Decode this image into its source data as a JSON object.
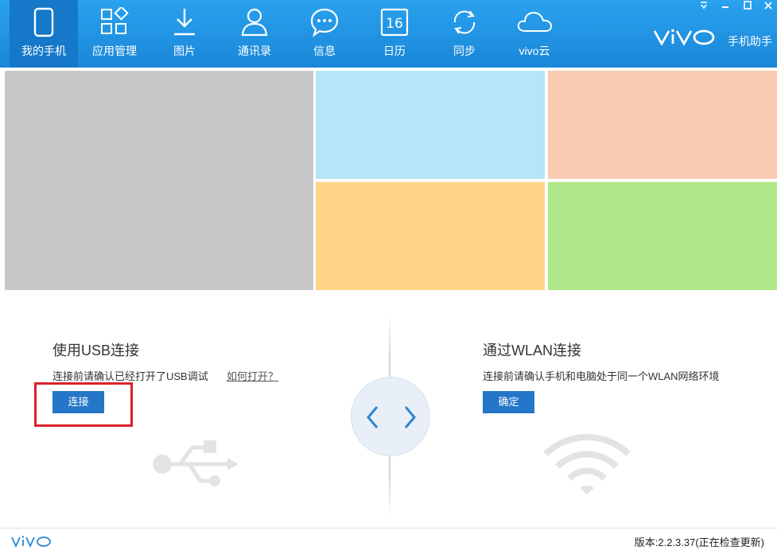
{
  "nav": {
    "items": [
      {
        "label": "我的手机",
        "icon": "phone-icon"
      },
      {
        "label": "应用管理",
        "icon": "apps-icon"
      },
      {
        "label": "图片",
        "icon": "download-icon"
      },
      {
        "label": "通讯录",
        "icon": "contact-icon"
      },
      {
        "label": "信息",
        "icon": "message-icon"
      },
      {
        "label": "日历",
        "icon": "calendar-icon"
      },
      {
        "label": "同步",
        "icon": "sync-icon"
      },
      {
        "label": "vivo云",
        "icon": "cloud-icon"
      }
    ],
    "calendar_day": "16",
    "brand_text": "手机助手"
  },
  "colors": {
    "nav_bg": "#1a86d8",
    "tile_gray": "#c8c8c8",
    "tile_blue": "#b5e5f8",
    "tile_peach": "#f9cbb3",
    "tile_orange": "#fdd48a",
    "tile_green": "#b1e88a",
    "button_blue": "#2576c8",
    "highlight_red": "#d9222a"
  },
  "usb": {
    "title": "使用USB连接",
    "desc": "连接前请确认已经打开了USB调试",
    "link": "如何打开？",
    "button": "连接"
  },
  "wlan": {
    "title": "通过WLAN连接",
    "desc": "连接前请确认手机和电脑处于同一个WLAN网络环境",
    "button": "确定"
  },
  "footer": {
    "version": "版本:2.2.3.37(正在检查更新)"
  }
}
